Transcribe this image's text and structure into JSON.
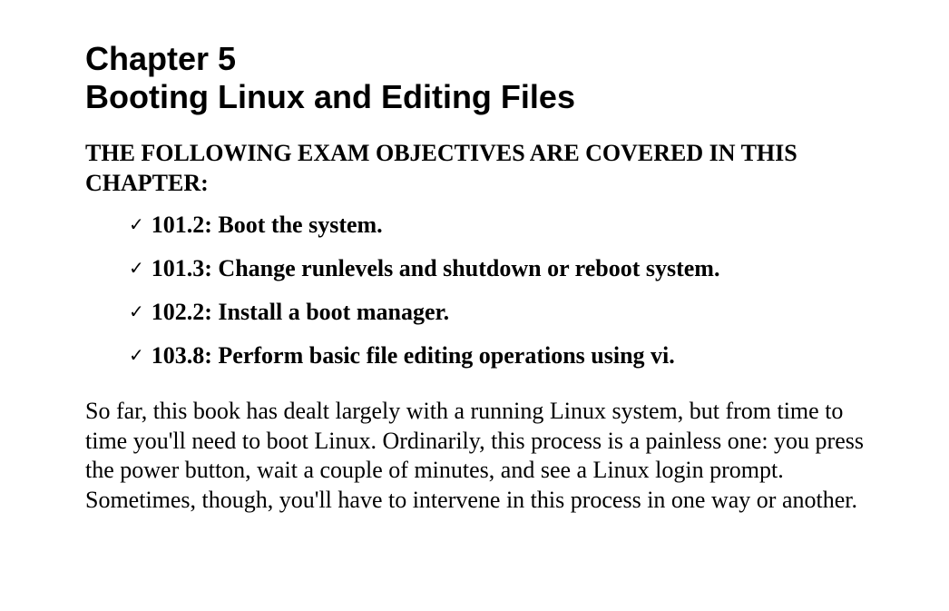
{
  "chapter": {
    "number_label": "Chapter 5",
    "title": "Booting Linux and Editing Files"
  },
  "objectives": {
    "heading": "THE FOLLOWING EXAM OBJECTIVES ARE COVERED IN THIS CHAPTER:",
    "check_glyph": "✓",
    "items": [
      {
        "text": "101.2: Boot the system."
      },
      {
        "text": "101.3: Change runlevels and shutdown or reboot system."
      },
      {
        "text": "102.2: Install a boot manager."
      },
      {
        "text": "103.8: Perform basic file editing operations using vi."
      }
    ]
  },
  "intro_paragraph": "So far, this book has dealt largely with a running Linux system, but from time to time you'll need to boot Linux. Ordinarily, this process is a painless one: you press the power button, wait a couple of minutes, and see a Linux login prompt. Sometimes, though, you'll have to intervene in this process in one way or another."
}
